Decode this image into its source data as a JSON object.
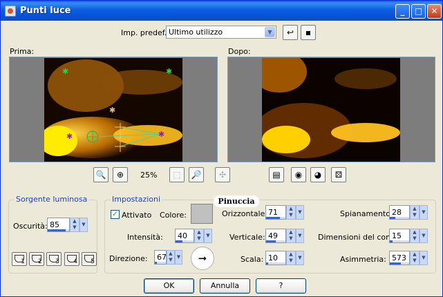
{
  "window": {
    "title": "Punti luce"
  },
  "preset": {
    "label": "Imp. predef.:",
    "value": "Ultimo utilizzo"
  },
  "preview": {
    "before_label": "Prima:",
    "after_label": "Dopo:",
    "zoom": "25%"
  },
  "light_source": {
    "group_title": "Sorgente luminosa",
    "darkness_label": "Oscurità:",
    "darkness_value": "85",
    "darkness_fill": 0.85,
    "presets": [
      "1",
      "2",
      "3",
      "4",
      "5"
    ]
  },
  "settings": {
    "group_title": "Impostazioni",
    "enabled_label": "Attivato",
    "enabled": true,
    "color_label": "Colore:",
    "color": "#c0c0c0",
    "intensity": {
      "label": "Intensità:",
      "value": "40",
      "fill": 0.4
    },
    "direction": {
      "label": "Direzione:",
      "value": "67",
      "fill": 0.19
    },
    "horizontal": {
      "label": "Orizzontale:",
      "value": "71",
      "fill": 0.71
    },
    "vertical": {
      "label": "Verticale:",
      "value": "49",
      "fill": 0.49
    },
    "scale": {
      "label": "Scala:",
      "value": "10",
      "fill": 0.1
    },
    "flattening": {
      "label": "Spianamento:",
      "value": "28",
      "fill": 0.28
    },
    "cone_size": {
      "label": "Dimensioni del cono:",
      "value": "15",
      "fill": 0.15
    },
    "asymmetry": {
      "label": "Asimmetria:",
      "value": "573",
      "fill": 0.57
    }
  },
  "watermark": "Pinuccia",
  "buttons": {
    "ok": "OK",
    "cancel": "Annulla",
    "help": "?"
  }
}
